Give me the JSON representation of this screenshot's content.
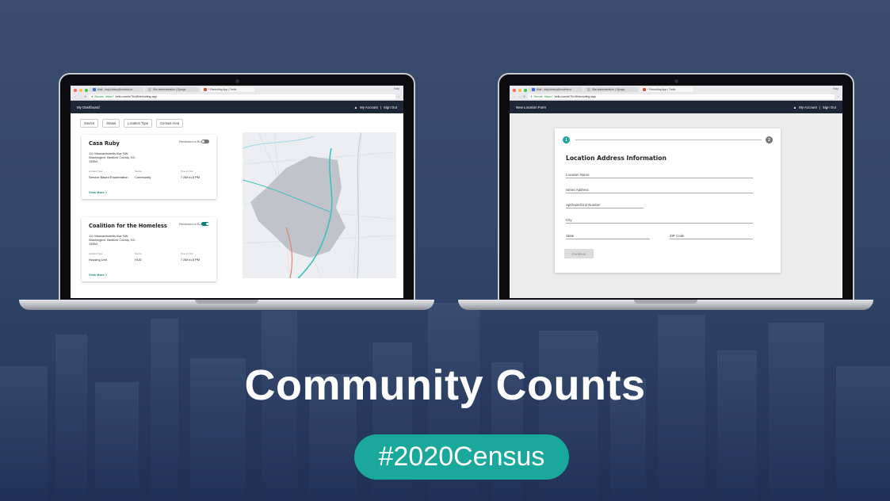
{
  "left_laptop": {
    "browser": {
      "tabs": [
        {
          "label": "Mail - katy.kinsey@excella.co"
        },
        {
          "label": "Site administration | Django"
        },
        {
          "label": "* Recruiting App | Trello"
        }
      ],
      "user": "Katy",
      "secure_label": "Secure",
      "url_prefix": "https://",
      "url": "trello.com/b/7hUt9/recruiting-app"
    },
    "nav": {
      "title": "My Dashboard",
      "account": "My Account",
      "separator": "|",
      "signout": "Sign Out"
    },
    "filters": [
      "Source",
      "Status",
      "Location Type",
      "Census Area"
    ],
    "cards": [
      {
        "name": "Casa Ruby",
        "reviewed_label": "Reviewed in BLQ",
        "reviewed": false,
        "address": "111 Massachusetts Ave NW Washington, Bedford County, DC, 15554",
        "location_type_label": "Location Type",
        "location_type": "Service Based Enumeration",
        "source_label": "Source",
        "source": "Community",
        "time_label": "Time to Visit",
        "time": "7 AM to 8 PM",
        "more": "View More >"
      },
      {
        "name": "Coalition for the Homeless",
        "reviewed_label": "Reviewed in BLQ",
        "reviewed": true,
        "address": "111 Massachusetts Ave NW Washington, Bedford County, DC, 15554",
        "location_type_label": "Location Type",
        "location_type": "Housing Unit",
        "source_label": "Source",
        "source": "HUD",
        "time_label": "Time to Visit",
        "time": "7 AM to 8 PM",
        "more": "View More >"
      }
    ]
  },
  "right_laptop": {
    "browser": {
      "tabs": [
        {
          "label": "Mail - katy.kinsey@excella.co"
        },
        {
          "label": "Site administration | Django"
        },
        {
          "label": "* Recruiting App | Trello"
        }
      ],
      "user": "Katy",
      "secure_label": "Secure",
      "url_prefix": "https://",
      "url": "trello.com/b/7hUt9/recruiting-app"
    },
    "nav": {
      "title": "New Location Form",
      "account": "My Account",
      "separator": "|",
      "signout": "Sign Out"
    },
    "form": {
      "step1": "1",
      "step2": "2",
      "title": "Location Address Information",
      "fields": {
        "location_name": "Location Name",
        "street": "Street Address",
        "apt": "Apt/Suite/Unit Number",
        "city": "City",
        "state": "State",
        "zip": "ZIP Code"
      },
      "continue": "Continue"
    }
  },
  "headline": "Community Counts",
  "hashtag": "#2020Census",
  "colors": {
    "accent": "#19a89b",
    "nav": "#1e2738",
    "toggle_on": "#0e7c78"
  }
}
